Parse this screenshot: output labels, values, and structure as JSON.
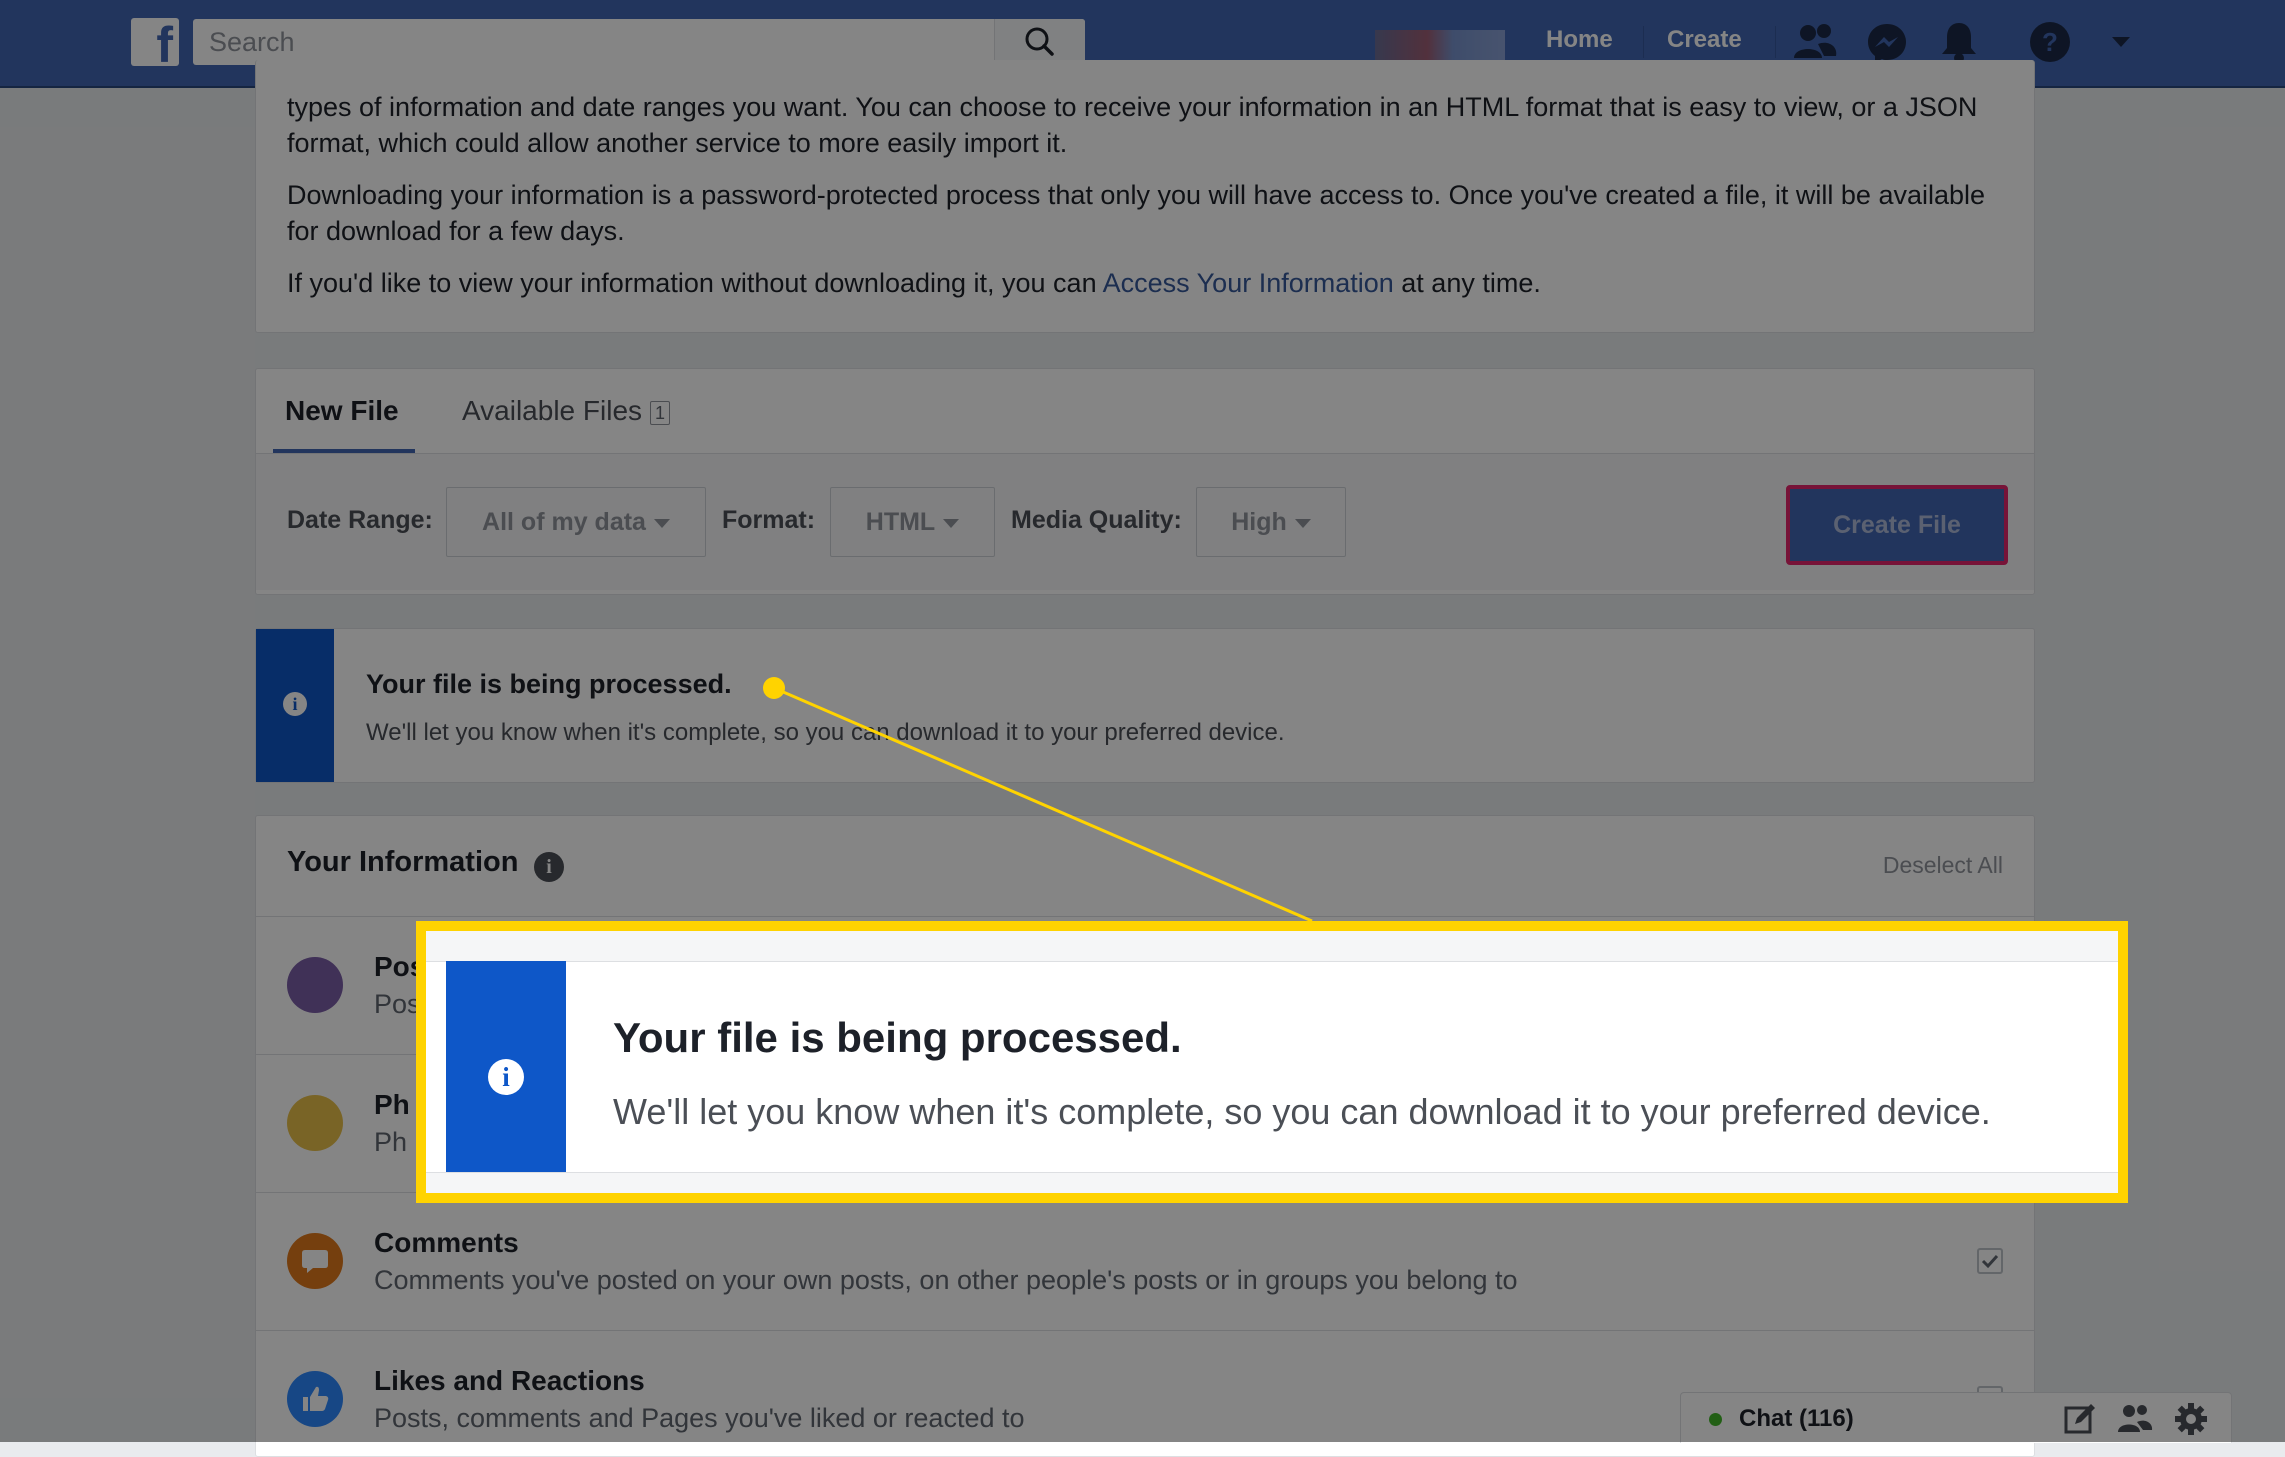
{
  "topbar": {
    "logo": "f",
    "search_placeholder": "Search",
    "nav": {
      "home": "Home",
      "create": "Create"
    },
    "icons": [
      "friends-icon",
      "messenger-icon",
      "notifications-icon",
      "help-icon",
      "account-menu-icon"
    ]
  },
  "intro": {
    "para1": "types of information and date ranges you want. You can choose to receive your information in an HTML format that is easy to view, or a JSON format, which could allow another service to more easily import it.",
    "para2": "Downloading your information is a password-protected process that only you will have access to. Once you've created a file, it will be available for download for a few days.",
    "para3_prefix": "If you'd like to view your information without downloading it, you can ",
    "para3_link": "Access Your Information",
    "para3_suffix": " at any time."
  },
  "tabs": {
    "new_file": "New File",
    "available_files": "Available Files",
    "available_count": "1"
  },
  "filters": {
    "date_range_label": "Date Range:",
    "date_range_value": "All of my data",
    "format_label": "Format:",
    "format_value": "HTML",
    "media_quality_label": "Media Quality:",
    "media_quality_value": "High",
    "create_button": "Create File"
  },
  "notice": {
    "title": "Your file is being processed.",
    "description": "We'll let you know when it's complete, so you can download it to your preferred device."
  },
  "your_information": {
    "title": "Your Information",
    "deselect_all": "Deselect All",
    "items": [
      {
        "title": "Pos",
        "desc": "Pos",
        "color": "#7b5ea7"
      },
      {
        "title": "Ph",
        "desc": "Ph",
        "color": "#e8c04a"
      },
      {
        "title": "Comments",
        "desc": "Comments you've posted on your own posts, on other people's posts or in groups you belong to",
        "color": "#e0791b"
      },
      {
        "title": "Likes and Reactions",
        "desc": "Posts, comments and Pages you've liked or reacted to",
        "color": "#2d88ff"
      }
    ]
  },
  "chat": {
    "label": "Chat (116)"
  },
  "colors": {
    "fb_blue": "#4267b2",
    "notice_blue": "#0e57c8",
    "callout_yellow": "#ffd300",
    "create_border": "#e4266b"
  }
}
